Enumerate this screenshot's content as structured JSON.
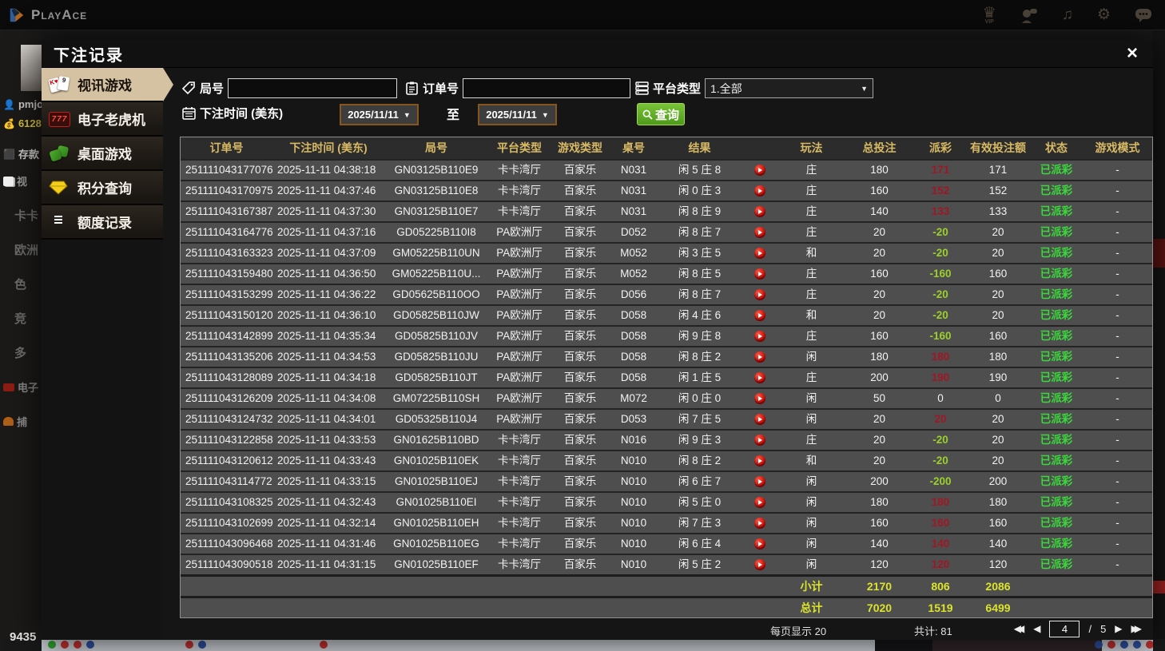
{
  "topbar": {
    "brand": "PlayAce",
    "vip_label": "VIP"
  },
  "background": {
    "username": "pmjo",
    "balance": "6128",
    "deposit": "存款",
    "left_nav": [
      "视",
      "卡卡",
      "欧洲",
      "色",
      "竞",
      "多",
      "电子",
      "捕"
    ],
    "bottom_left_number": "9435"
  },
  "modal": {
    "title": "下注记录",
    "close_glyph": "×",
    "sidebar": [
      {
        "label": "视讯游戏"
      },
      {
        "label": "电子老虎机"
      },
      {
        "label": "桌面游戏"
      },
      {
        "label": "积分查询"
      },
      {
        "label": "额度记录"
      }
    ],
    "filters": {
      "round_label": "局号",
      "order_label": "订单号",
      "platform_label": "平台类型",
      "platform_value": "1.全部",
      "time_label": "下注时间 (美东)",
      "date_from": "2025/11/11",
      "to_label": "至",
      "date_to": "2025/11/11",
      "query_label": "查询"
    },
    "table": {
      "headers": [
        "订单号",
        "下注时间 (美东)",
        "局号",
        "平台类型",
        "游戏类型",
        "桌号",
        "结果",
        "玩法",
        "总投注",
        "派彩",
        "有效投注额",
        "状态",
        "游戏模式"
      ],
      "rows": [
        {
          "order": "251111043177076",
          "time": "2025-11-11 04:38:18",
          "round": "GN03125B110E9",
          "platform": "卡卡湾厅",
          "game": "百家乐",
          "table": "N031",
          "result": "闲 5 庄 8",
          "play_type": "庄",
          "bet": "180",
          "payout": "171",
          "payout_type": "pos",
          "valid": "171",
          "status": "已派彩",
          "mode": "-"
        },
        {
          "order": "251111043170975",
          "time": "2025-11-11 04:37:46",
          "round": "GN03125B110E8",
          "platform": "卡卡湾厅",
          "game": "百家乐",
          "table": "N031",
          "result": "闲 0 庄 3",
          "play_type": "庄",
          "bet": "160",
          "payout": "152",
          "payout_type": "pos",
          "valid": "152",
          "status": "已派彩",
          "mode": "-"
        },
        {
          "order": "251111043167387",
          "time": "2025-11-11 04:37:30",
          "round": "GN03125B110E7",
          "platform": "卡卡湾厅",
          "game": "百家乐",
          "table": "N031",
          "result": "闲 8 庄 9",
          "play_type": "庄",
          "bet": "140",
          "payout": "133",
          "payout_type": "pos",
          "valid": "133",
          "status": "已派彩",
          "mode": "-"
        },
        {
          "order": "251111043164776",
          "time": "2025-11-11 04:37:16",
          "round": "GD05225B110I8",
          "platform": "PA欧洲厅",
          "game": "百家乐",
          "table": "D052",
          "result": "闲 8 庄 7",
          "play_type": "庄",
          "bet": "20",
          "payout": "-20",
          "payout_type": "neg",
          "valid": "20",
          "status": "已派彩",
          "mode": "-"
        },
        {
          "order": "251111043163323",
          "time": "2025-11-11 04:37:09",
          "round": "GM05225B110UN",
          "platform": "PA欧洲厅",
          "game": "百家乐",
          "table": "M052",
          "result": "闲 3 庄 5",
          "play_type": "和",
          "bet": "20",
          "payout": "-20",
          "payout_type": "neg",
          "valid": "20",
          "status": "已派彩",
          "mode": "-"
        },
        {
          "order": "251111043159480",
          "time": "2025-11-11 04:36:50",
          "round": "GM05225B110U...",
          "platform": "PA欧洲厅",
          "game": "百家乐",
          "table": "M052",
          "result": "闲 8 庄 5",
          "play_type": "庄",
          "bet": "160",
          "payout": "-160",
          "payout_type": "neg",
          "valid": "160",
          "status": "已派彩",
          "mode": "-"
        },
        {
          "order": "251111043153299",
          "time": "2025-11-11 04:36:22",
          "round": "GD05625B110OO",
          "platform": "PA欧洲厅",
          "game": "百家乐",
          "table": "D056",
          "result": "闲 8 庄 7",
          "play_type": "庄",
          "bet": "20",
          "payout": "-20",
          "payout_type": "neg",
          "valid": "20",
          "status": "已派彩",
          "mode": "-"
        },
        {
          "order": "251111043150120",
          "time": "2025-11-11 04:36:10",
          "round": "GD05825B110JW",
          "platform": "PA欧洲厅",
          "game": "百家乐",
          "table": "D058",
          "result": "闲 4 庄 6",
          "play_type": "和",
          "bet": "20",
          "payout": "-20",
          "payout_type": "neg",
          "valid": "20",
          "status": "已派彩",
          "mode": "-"
        },
        {
          "order": "251111043142899",
          "time": "2025-11-11 04:35:34",
          "round": "GD05825B110JV",
          "platform": "PA欧洲厅",
          "game": "百家乐",
          "table": "D058",
          "result": "闲 9 庄 8",
          "play_type": "庄",
          "bet": "160",
          "payout": "-160",
          "payout_type": "neg",
          "valid": "160",
          "status": "已派彩",
          "mode": "-"
        },
        {
          "order": "251111043135206",
          "time": "2025-11-11 04:34:53",
          "round": "GD05825B110JU",
          "platform": "PA欧洲厅",
          "game": "百家乐",
          "table": "D058",
          "result": "闲 8 庄 2",
          "play_type": "闲",
          "bet": "180",
          "payout": "180",
          "payout_type": "pos",
          "valid": "180",
          "status": "已派彩",
          "mode": "-"
        },
        {
          "order": "251111043128089",
          "time": "2025-11-11 04:34:18",
          "round": "GD05825B110JT",
          "platform": "PA欧洲厅",
          "game": "百家乐",
          "table": "D058",
          "result": "闲 1 庄 5",
          "play_type": "庄",
          "bet": "200",
          "payout": "190",
          "payout_type": "pos",
          "valid": "190",
          "status": "已派彩",
          "mode": "-"
        },
        {
          "order": "251111043126209",
          "time": "2025-11-11 04:34:08",
          "round": "GM07225B110SH",
          "platform": "PA欧洲厅",
          "game": "百家乐",
          "table": "M072",
          "result": "闲 0 庄 0",
          "play_type": "闲",
          "bet": "50",
          "payout": "0",
          "payout_type": "zero",
          "valid": "0",
          "status": "已派彩",
          "mode": "-"
        },
        {
          "order": "251111043124732",
          "time": "2025-11-11 04:34:01",
          "round": "GD05325B110J4",
          "platform": "PA欧洲厅",
          "game": "百家乐",
          "table": "D053",
          "result": "闲 7 庄 5",
          "play_type": "闲",
          "bet": "20",
          "payout": "20",
          "payout_type": "pos",
          "valid": "20",
          "status": "已派彩",
          "mode": "-"
        },
        {
          "order": "251111043122858",
          "time": "2025-11-11 04:33:53",
          "round": "GN01625B110BD",
          "platform": "卡卡湾厅",
          "game": "百家乐",
          "table": "N016",
          "result": "闲 9 庄 3",
          "play_type": "庄",
          "bet": "20",
          "payout": "-20",
          "payout_type": "neg",
          "valid": "20",
          "status": "已派彩",
          "mode": "-"
        },
        {
          "order": "251111043120612",
          "time": "2025-11-11 04:33:43",
          "round": "GN01025B110EK",
          "platform": "卡卡湾厅",
          "game": "百家乐",
          "table": "N010",
          "result": "闲 8 庄 2",
          "play_type": "和",
          "bet": "20",
          "payout": "-20",
          "payout_type": "neg",
          "valid": "20",
          "status": "已派彩",
          "mode": "-"
        },
        {
          "order": "251111043114772",
          "time": "2025-11-11 04:33:15",
          "round": "GN01025B110EJ",
          "platform": "卡卡湾厅",
          "game": "百家乐",
          "table": "N010",
          "result": "闲 6 庄 7",
          "play_type": "闲",
          "bet": "200",
          "payout": "-200",
          "payout_type": "neg",
          "valid": "200",
          "status": "已派彩",
          "mode": "-"
        },
        {
          "order": "251111043108325",
          "time": "2025-11-11 04:32:43",
          "round": "GN01025B110EI",
          "platform": "卡卡湾厅",
          "game": "百家乐",
          "table": "N010",
          "result": "闲 5 庄 0",
          "play_type": "闲",
          "bet": "180",
          "payout": "180",
          "payout_type": "pos",
          "valid": "180",
          "status": "已派彩",
          "mode": "-"
        },
        {
          "order": "251111043102699",
          "time": "2025-11-11 04:32:14",
          "round": "GN01025B110EH",
          "platform": "卡卡湾厅",
          "game": "百家乐",
          "table": "N010",
          "result": "闲 7 庄 3",
          "play_type": "闲",
          "bet": "160",
          "payout": "160",
          "payout_type": "pos",
          "valid": "160",
          "status": "已派彩",
          "mode": "-"
        },
        {
          "order": "251111043096468",
          "time": "2025-11-11 04:31:46",
          "round": "GN01025B110EG",
          "platform": "卡卡湾厅",
          "game": "百家乐",
          "table": "N010",
          "result": "闲 6 庄 4",
          "play_type": "闲",
          "bet": "140",
          "payout": "140",
          "payout_type": "pos",
          "valid": "140",
          "status": "已派彩",
          "mode": "-"
        },
        {
          "order": "251111043090518",
          "time": "2025-11-11 04:31:15",
          "round": "GN01025B110EF",
          "platform": "卡卡湾厅",
          "game": "百家乐",
          "table": "N010",
          "result": "闲 5 庄 2",
          "play_type": "闲",
          "bet": "120",
          "payout": "120",
          "payout_type": "pos",
          "valid": "120",
          "status": "已派彩",
          "mode": "-"
        }
      ],
      "subtotal": {
        "label": "小计",
        "bet": "2170",
        "payout": "806",
        "valid": "2086"
      },
      "total": {
        "label": "总计",
        "bet": "7020",
        "payout": "1519",
        "valid": "6499"
      }
    },
    "pagination": {
      "per_page": "每页显示 20",
      "total_count": "共计: 81",
      "current_page": "4",
      "page_sep": "/",
      "total_pages": "5"
    }
  }
}
